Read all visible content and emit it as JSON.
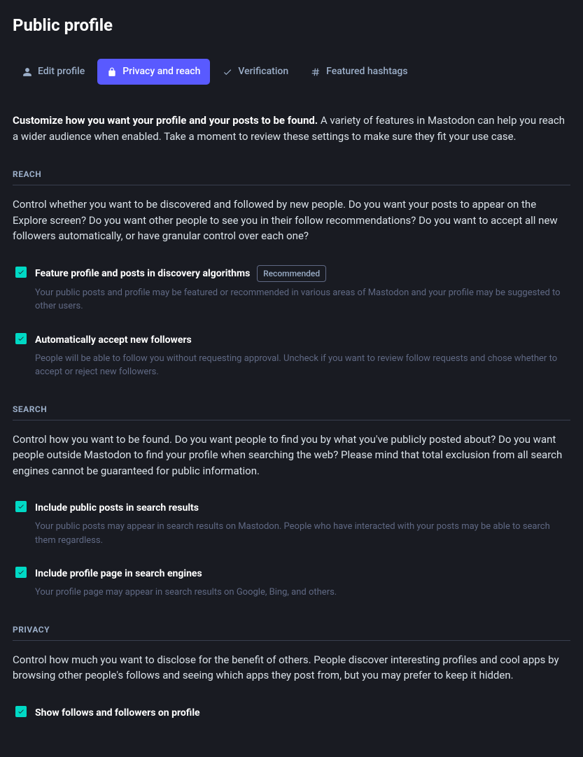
{
  "page_title": "Public profile",
  "tabs": {
    "edit": "Edit profile",
    "privacy": "Privacy and reach",
    "verification": "Verification",
    "hashtags": "Featured hashtags"
  },
  "intro": {
    "bold": "Customize how you want your profile and your posts to be found.",
    "text": " A variety of features in Mastodon can help you reach a wider audience when enabled. Take a moment to review these settings to make sure they fit your use case."
  },
  "reach": {
    "header": "Reach",
    "desc": "Control whether you want to be discovered and followed by new people. Do you want your posts to appear on the Explore screen? Do you want other people to see you in their follow recommendations? Do you want to accept all new followers automatically, or have granular control over each one?",
    "feature_label": "Feature profile and posts in discovery algorithms",
    "feature_badge": "Recommended",
    "feature_hint": "Your public posts and profile may be featured or recommended in various areas of Mastodon and your profile may be suggested to other users.",
    "auto_label": "Automatically accept new followers",
    "auto_hint": "People will be able to follow you without requesting approval. Uncheck if you want to review follow requests and chose whether to accept or reject new followers."
  },
  "search": {
    "header": "Search",
    "desc": "Control how you want to be found. Do you want people to find you by what you've publicly posted about? Do you want people outside Mastodon to find your profile when searching the web? Please mind that total exclusion from all search engines cannot be guaranteed for public information.",
    "posts_label": "Include public posts in search results",
    "posts_hint": "Your public posts may appear in search results on Mastodon. People who have interacted with your posts may be able to search them regardless.",
    "engines_label": "Include profile page in search engines",
    "engines_hint": "Your profile page may appear in search results on Google, Bing, and others."
  },
  "privacy": {
    "header": "Privacy",
    "desc": "Control how much you want to disclose for the benefit of others. People discover interesting profiles and cool apps by browsing other people's follows and seeing which apps they post from, but you may prefer to keep it hidden.",
    "follows_label": "Show follows and followers on profile"
  }
}
